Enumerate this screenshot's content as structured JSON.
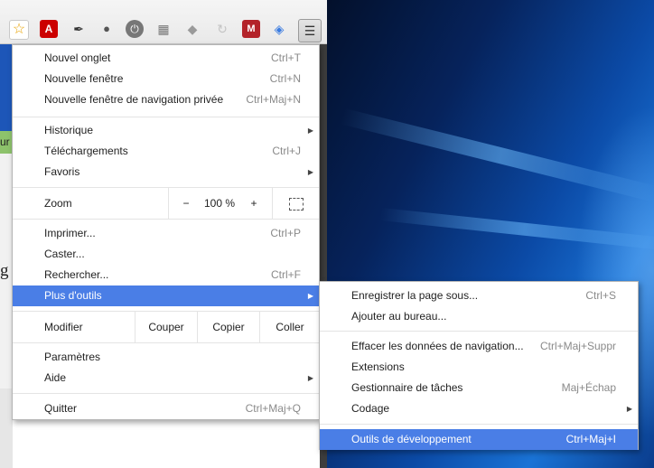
{
  "toolbar": {
    "icons": [
      "bookmark-star-icon",
      "acrobat-icon",
      "pen-icon",
      "evernote-icon",
      "power-icon",
      "reader-icon",
      "dropbox-icon",
      "sync-icon",
      "mendeley-icon",
      "layers-icon"
    ],
    "menu_button_icon": "hamburger-menu-icon"
  },
  "page": {
    "fragment_green": "ur",
    "fragment_g": "g"
  },
  "main_menu": {
    "new_tab": {
      "label": "Nouvel onglet",
      "shortcut": "Ctrl+T"
    },
    "new_window": {
      "label": "Nouvelle fenêtre",
      "shortcut": "Ctrl+N"
    },
    "private_window": {
      "label": "Nouvelle fenêtre de navigation privée",
      "shortcut": "Ctrl+Maj+N"
    },
    "history": {
      "label": "Historique"
    },
    "downloads": {
      "label": "Téléchargements",
      "shortcut": "Ctrl+J"
    },
    "bookmarks": {
      "label": "Favoris"
    },
    "zoom": {
      "label": "Zoom",
      "minus": "−",
      "value": "100 %",
      "plus": "+",
      "fullscreen_icon": "fullscreen-icon"
    },
    "print": {
      "label": "Imprimer...",
      "shortcut": "Ctrl+P"
    },
    "cast": {
      "label": "Caster..."
    },
    "find": {
      "label": "Rechercher...",
      "shortcut": "Ctrl+F"
    },
    "more_tools": {
      "label": "Plus d'outils"
    },
    "edit": {
      "label": "Modifier",
      "cut": "Couper",
      "copy": "Copier",
      "paste": "Coller"
    },
    "settings": {
      "label": "Paramètres"
    },
    "help": {
      "label": "Aide"
    },
    "quit": {
      "label": "Quitter",
      "shortcut": "Ctrl+Maj+Q"
    }
  },
  "sub_menu": {
    "save_page": {
      "label": "Enregistrer la page sous...",
      "shortcut": "Ctrl+S"
    },
    "add_desktop": {
      "label": "Ajouter au bureau..."
    },
    "clear_data": {
      "label": "Effacer les données de navigation...",
      "shortcut": "Ctrl+Maj+Suppr"
    },
    "extensions": {
      "label": "Extensions"
    },
    "task_manager": {
      "label": "Gestionnaire de tâches",
      "shortcut": "Maj+Échap"
    },
    "encoding": {
      "label": "Codage"
    },
    "dev_tools": {
      "label": "Outils de développement",
      "shortcut": "Ctrl+Maj+I"
    }
  },
  "colors": {
    "highlight": "#4a7ee6",
    "desktop": "#0b4aa6"
  }
}
